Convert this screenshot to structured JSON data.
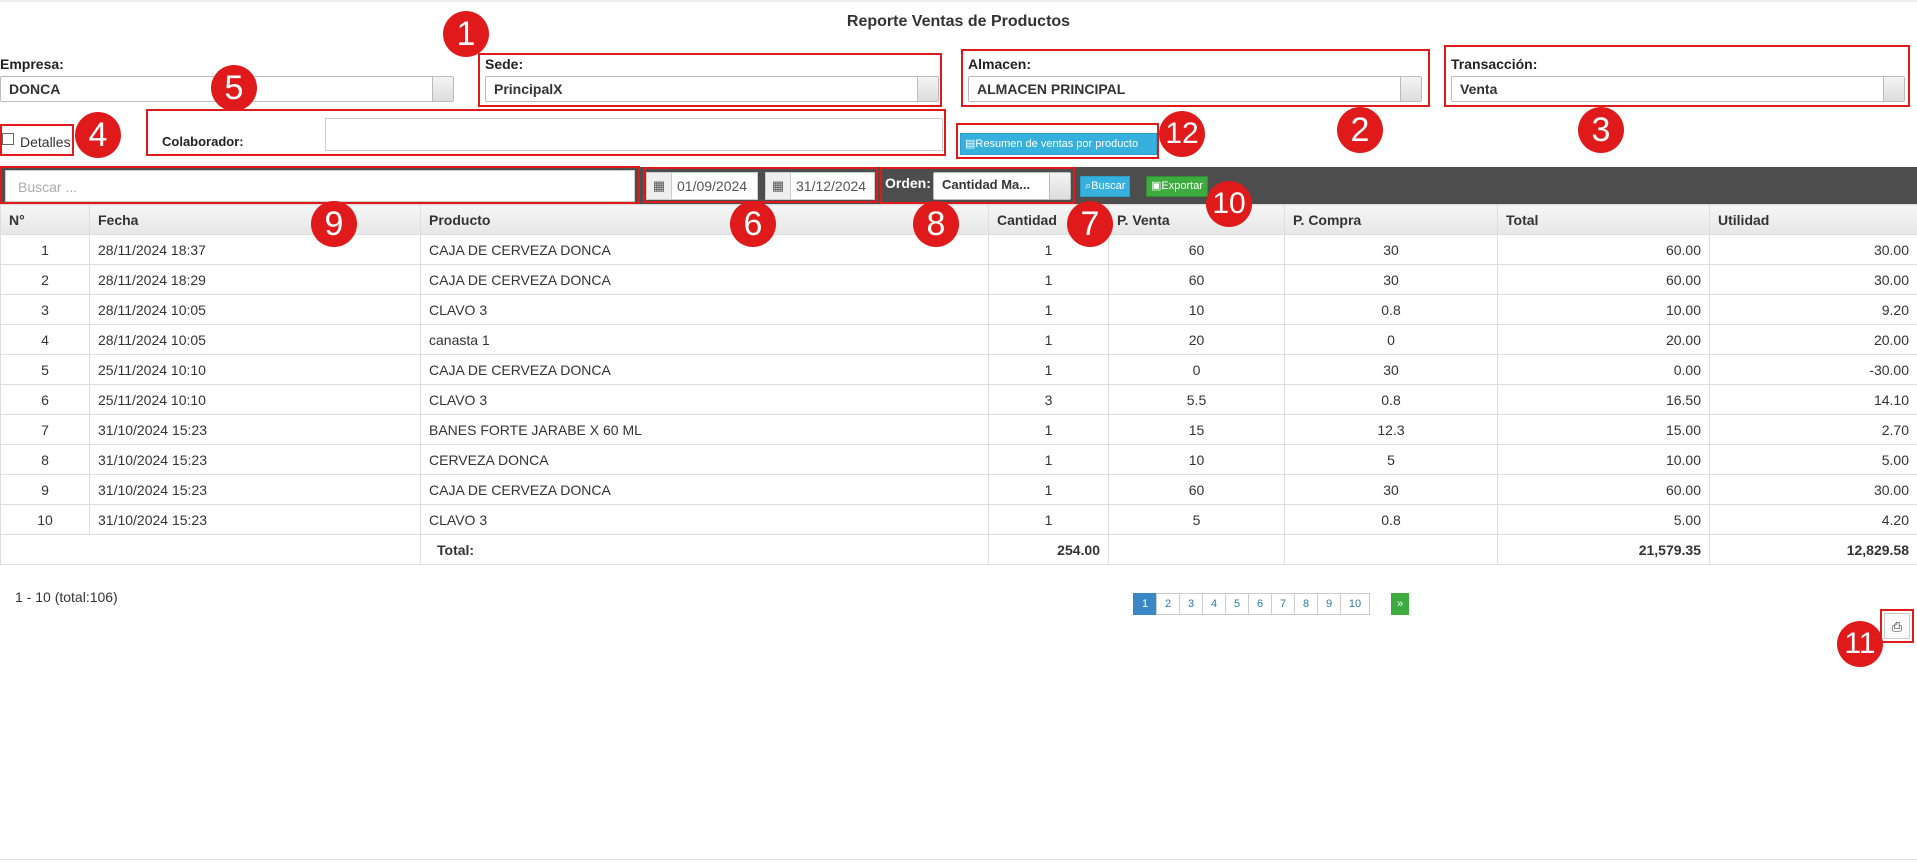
{
  "title": "Reporte Ventas de Productos",
  "filters": {
    "empresa_label": "Empresa:",
    "empresa_value": "DONCA",
    "sede_label": "Sede:",
    "sede_value": "PrincipalX",
    "almacen_label": "Almacen:",
    "almacen_value": "ALMACEN PRINCIPAL",
    "transaccion_label": "Transacción:",
    "transaccion_value": "Venta",
    "detalles_label": "Detalles",
    "colaborador_label": "Colaborador:",
    "colaborador_value": "",
    "resumen_button": "Resumen de ventas por producto"
  },
  "toolbar": {
    "search_placeholder": "Buscar ...",
    "date_from": "01/09/2024",
    "date_to": "31/12/2024",
    "orden_label": "Orden:",
    "orden_value": "Cantidad Ma...",
    "buscar_label": "Buscar",
    "exportar_label": "Exportar"
  },
  "table": {
    "headers": [
      "N°",
      "Fecha",
      "Producto",
      "Cantidad",
      "P. Venta",
      "P. Compra",
      "Total",
      "Utilidad"
    ],
    "rows": [
      [
        "1",
        "28/11/2024 18:37",
        "CAJA DE CERVEZA DONCA",
        "1",
        "60",
        "30",
        "60.00",
        "30.00"
      ],
      [
        "2",
        "28/11/2024 18:29",
        "CAJA DE CERVEZA DONCA",
        "1",
        "60",
        "30",
        "60.00",
        "30.00"
      ],
      [
        "3",
        "28/11/2024 10:05",
        "CLAVO 3",
        "1",
        "10",
        "0.8",
        "10.00",
        "9.20"
      ],
      [
        "4",
        "28/11/2024 10:05",
        "canasta 1",
        "1",
        "20",
        "0",
        "20.00",
        "20.00"
      ],
      [
        "5",
        "25/11/2024 10:10",
        "CAJA DE CERVEZA DONCA",
        "1",
        "0",
        "30",
        "0.00",
        "-30.00"
      ],
      [
        "6",
        "25/11/2024 10:10",
        "CLAVO 3",
        "3",
        "5.5",
        "0.8",
        "16.50",
        "14.10"
      ],
      [
        "7",
        "31/10/2024 15:23",
        "BANES FORTE JARABE X 60 ML",
        "1",
        "15",
        "12.3",
        "15.00",
        "2.70"
      ],
      [
        "8",
        "31/10/2024 15:23",
        "CERVEZA DONCA",
        "1",
        "10",
        "5",
        "10.00",
        "5.00"
      ],
      [
        "9",
        "31/10/2024 15:23",
        "CAJA DE CERVEZA DONCA",
        "1",
        "60",
        "30",
        "60.00",
        "30.00"
      ],
      [
        "10",
        "31/10/2024 15:23",
        "CLAVO 3",
        "1",
        "5",
        "0.8",
        "5.00",
        "4.20"
      ]
    ],
    "total_label": "Total:",
    "total_cantidad": "254.00",
    "total_total": "21,579.35",
    "total_utilidad": "12,829.58"
  },
  "pagination": {
    "summary": "1 - 10 (total:106)",
    "pages": [
      "1",
      "2",
      "3",
      "4",
      "5",
      "6",
      "7",
      "8",
      "9",
      "10"
    ],
    "next": "»"
  },
  "markers": [
    "1",
    "2",
    "3",
    "4",
    "5",
    "6",
    "7",
    "8",
    "9",
    "10",
    "11",
    "12"
  ],
  "colors": {
    "marker_red": "#e01a1a",
    "toolbar_bg": "#4d4d4d",
    "buscar_btn": "#36b1dd",
    "exportar_btn": "#3dab3d",
    "active_page": "#3a87c8"
  }
}
